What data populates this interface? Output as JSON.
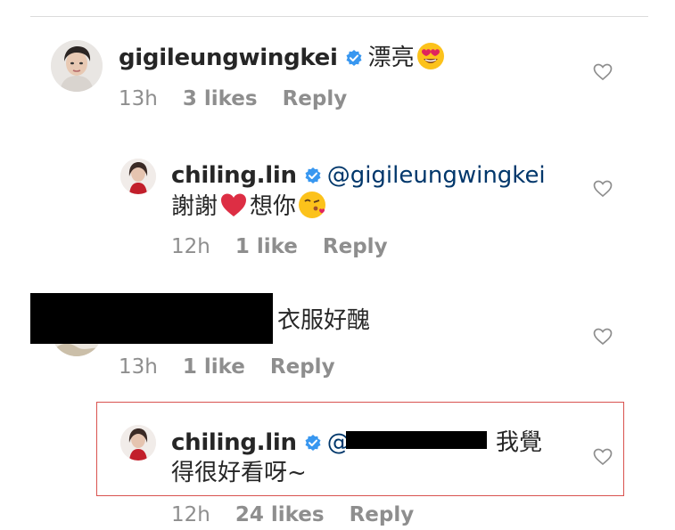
{
  "comments": [
    {
      "username": "gigileungwingkei",
      "verified": true,
      "text": "漂亮",
      "emoji": "heart-eyes-emoji",
      "time": "13h",
      "likes": "3 likes",
      "reply_label": "Reply"
    },
    {
      "username": "chiling.lin",
      "verified": true,
      "mention": "@gigileungwingkei",
      "text_line2_a": "謝謝",
      "emoji_heart": "red-heart-emoji",
      "text_line2_b": "想你",
      "emoji_kiss": "kissing-face-emoji",
      "time": "12h",
      "likes": "1 like",
      "reply_label": "Reply"
    },
    {
      "username": "",
      "text": "衣服好醜",
      "time": "13h",
      "likes": "1 like",
      "reply_label": "Reply"
    },
    {
      "username": "chiling.lin",
      "verified": true,
      "mention": "@",
      "text_line1": "我覺",
      "text_line2": "得很好看呀~",
      "time": "12h",
      "likes": "24 likes",
      "reply_label": "Reply"
    }
  ],
  "colors": {
    "text": "#262626",
    "meta": "#8e8e8e",
    "mention": "#00376b",
    "verified": "#3897f0",
    "highlight_border": "#d9534f",
    "divider": "#dbdbdb"
  }
}
